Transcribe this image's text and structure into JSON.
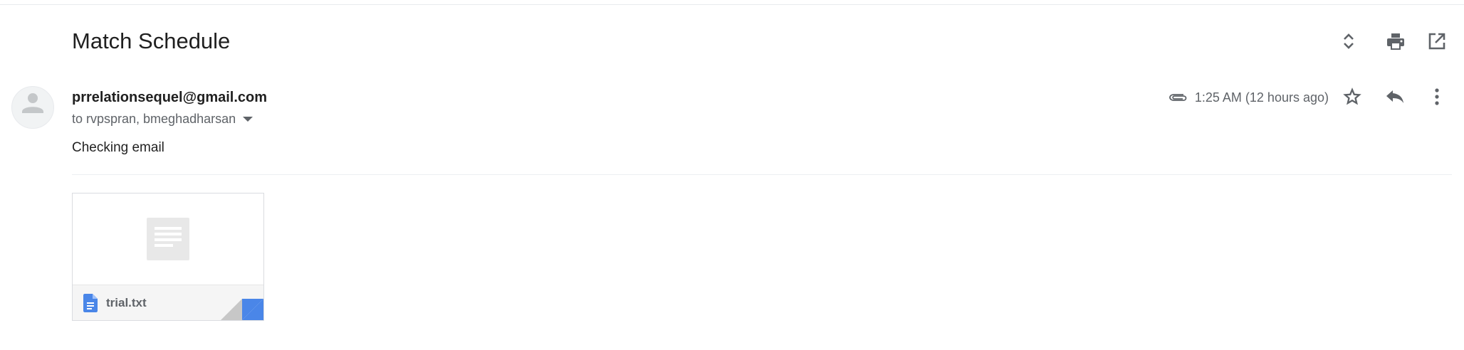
{
  "email": {
    "subject": "Match Schedule",
    "sender": "prrelationsequel@gmail.com",
    "recipients": "to rvpspran, bmeghadharsan",
    "timestamp": "1:25 AM (12 hours ago)",
    "body": "Checking email"
  },
  "header_actions": [
    {
      "name": "expand-all-icon"
    },
    {
      "name": "print-icon"
    },
    {
      "name": "open-new-window-icon"
    }
  ],
  "message_actions": [
    {
      "name": "star-icon"
    },
    {
      "name": "reply-icon"
    },
    {
      "name": "more-options-icon"
    }
  ],
  "attachment": {
    "file_name": "trial.txt",
    "file_icon": "google-docs-icon",
    "accent_color": "#4a86e8"
  },
  "colors": {
    "secondary_text": "#5f6368",
    "icon": "#5f6368",
    "divider": "#e8eaed"
  }
}
